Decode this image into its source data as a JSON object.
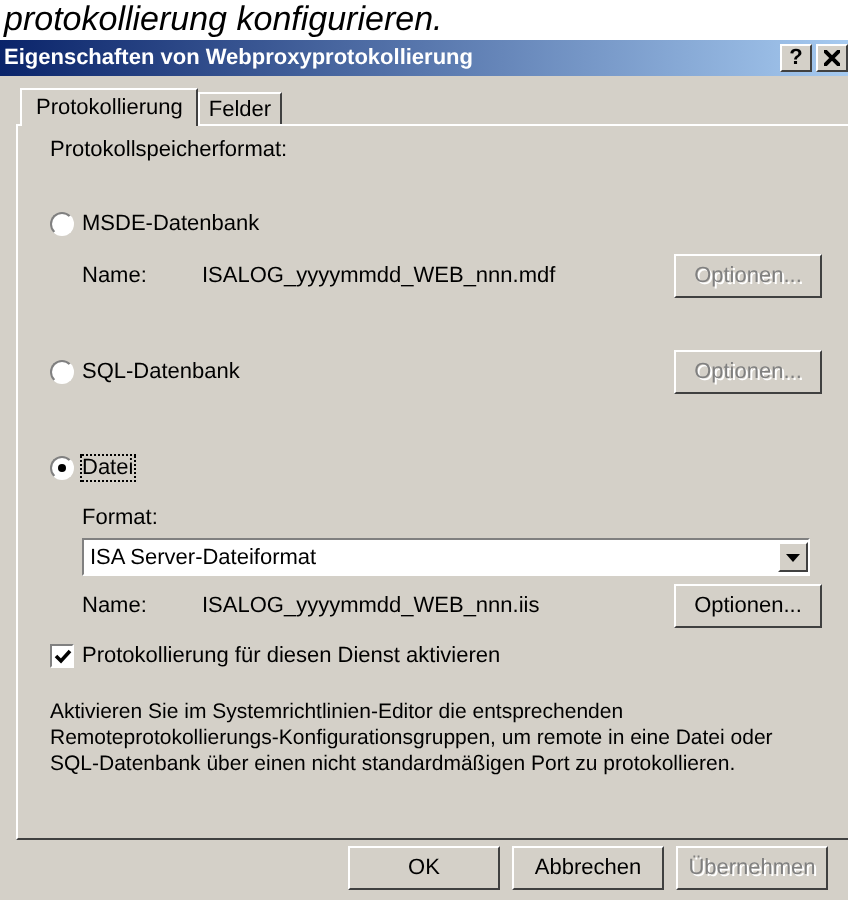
{
  "page_heading": "protokollierung konfigurieren.",
  "window": {
    "title": "Eigenschaften von Webproxyprotokollierung",
    "help": "?"
  },
  "tabs": [
    {
      "label": "Protokollierung",
      "selected": true
    },
    {
      "label": "Felder",
      "selected": false
    }
  ],
  "section_label": "Protokollspeicherformat:",
  "options": [
    {
      "label": "MSDE-Datenbank",
      "selected": false,
      "name_label": "Name:",
      "name_value": "ISALOG_yyyymmdd_WEB_nnn.mdf",
      "button": {
        "label": "Optionen...",
        "disabled": true
      }
    },
    {
      "label": "SQL-Datenbank",
      "selected": false,
      "button": {
        "label": "Optionen...",
        "disabled": true
      }
    },
    {
      "label": "Datei",
      "selected": true,
      "format_label": "Format:",
      "format_value": "ISA Server-Dateiformat",
      "name_label": "Name:",
      "name_value": "ISALOG_yyyymmdd_WEB_nnn.iis",
      "button": {
        "label": "Optionen...",
        "disabled": false
      }
    }
  ],
  "enable_checkbox": {
    "label": "Protokollierung für diesen Dienst aktivieren",
    "checked": true
  },
  "info_text": "Aktivieren Sie im Systemrichtlinien-Editor die entsprechenden Remoteprotokollierungs-Konfigurationsgruppen, um remote in eine Datei oder SQL-Datenbank über einen nicht standardmäßigen Port zu protokollieren.",
  "buttons": [
    {
      "label": "OK",
      "disabled": false
    },
    {
      "label": "Abbrechen",
      "disabled": false
    },
    {
      "label": "Übernehmen",
      "disabled": true
    }
  ]
}
